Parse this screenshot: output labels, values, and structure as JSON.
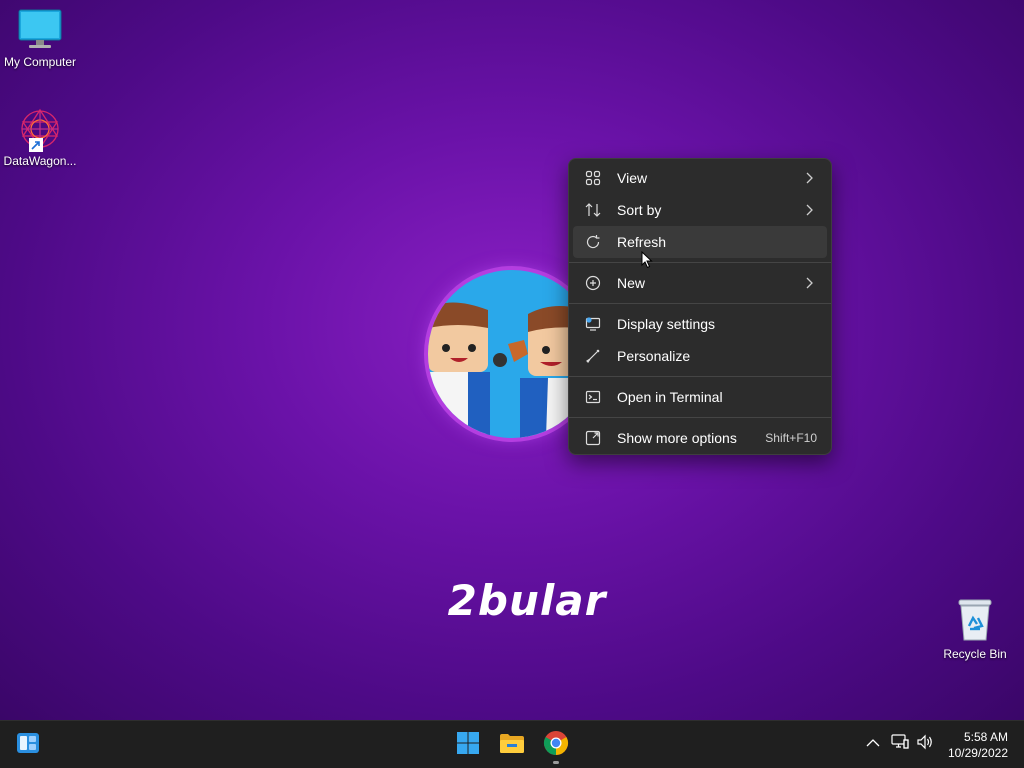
{
  "desktop": {
    "icons": [
      {
        "label": "My Computer",
        "icon": "monitor-icon"
      },
      {
        "label": "DataWagon...",
        "icon": "datawagon-shortcut-icon"
      },
      {
        "label": "Recycle Bin",
        "icon": "recycle-bin-icon"
      }
    ],
    "wallpaper_text": "2bular"
  },
  "context_menu": {
    "items": [
      {
        "label": "View",
        "icon": "grid-view-icon",
        "submenu": true
      },
      {
        "label": "Sort by",
        "icon": "sort-arrows-icon",
        "submenu": true
      },
      {
        "label": "Refresh",
        "icon": "refresh-icon",
        "submenu": false,
        "hovered": true
      },
      {
        "label": "New",
        "icon": "plus-circle-icon",
        "submenu": true
      },
      {
        "label": "Display settings",
        "icon": "display-settings-icon",
        "submenu": false
      },
      {
        "label": "Personalize",
        "icon": "brush-icon",
        "submenu": false
      },
      {
        "label": "Open in Terminal",
        "icon": "terminal-icon",
        "submenu": false
      },
      {
        "label": "Show more options",
        "icon": "expand-options-icon",
        "submenu": false,
        "shortcut": "Shift+F10"
      }
    ]
  },
  "taskbar": {
    "apps": [
      "start-icon",
      "file-explorer-icon",
      "chrome-icon"
    ],
    "widgets_icon": "widgets-icon",
    "tray": [
      "chevron-up-icon",
      "network-icon",
      "volume-icon"
    ],
    "time": "5:58 AM",
    "date": "10/29/2022"
  },
  "colors": {
    "menu_bg": "#2c2c2c",
    "taskbar_bg": "#1f1f1f",
    "accent": "#2aa8ea"
  }
}
